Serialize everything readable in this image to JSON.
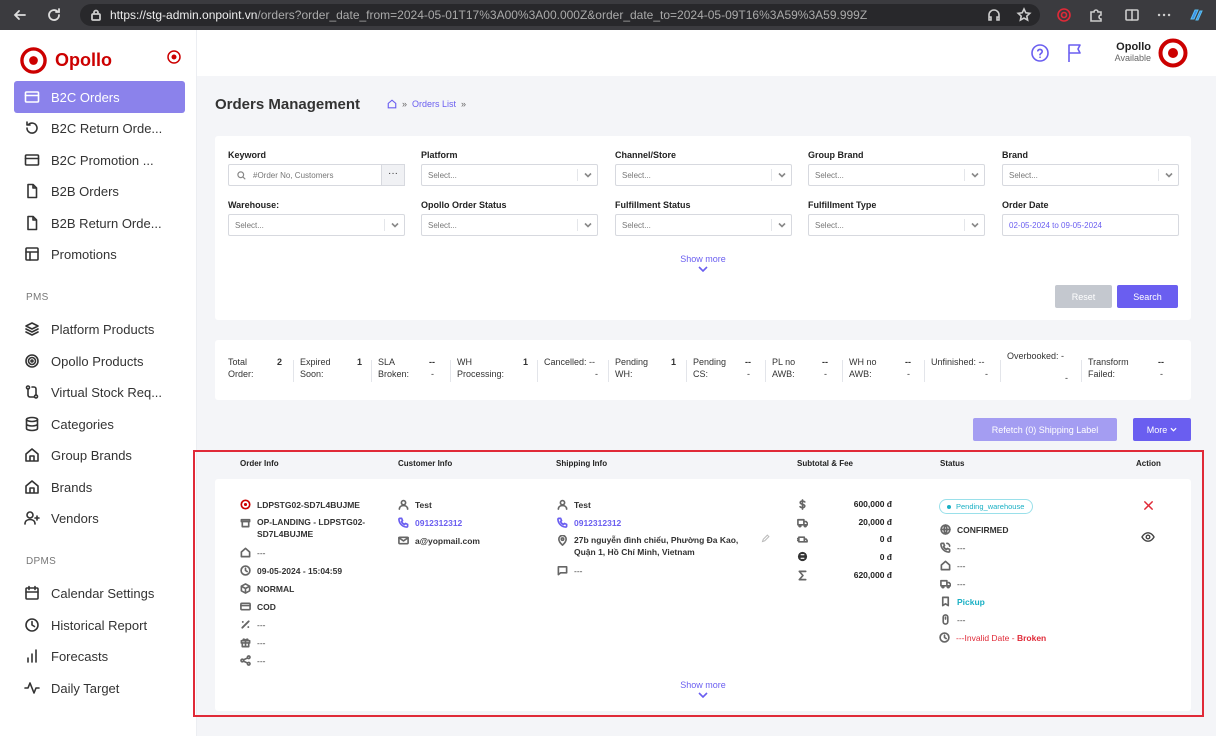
{
  "browser": {
    "url_host": "https://stg-admin.onpoint.vn",
    "url_rest": "/orders?order_date_from=2024-05-01T17%3A00%3A00.000Z&order_date_to=2024-05-09T16%3A59%3A59.999Z"
  },
  "sidebar": {
    "brand": "Opollo",
    "items": [
      {
        "label": "B2C Orders",
        "icon": "card-icon"
      },
      {
        "label": "B2C Return Orde...",
        "icon": "return-icon"
      },
      {
        "label": "B2C Promotion ...",
        "icon": "card-icon"
      },
      {
        "label": "B2B Orders",
        "icon": "file-icon"
      },
      {
        "label": "B2B Return Orde...",
        "icon": "file-icon"
      },
      {
        "label": "Promotions",
        "icon": "layout-icon"
      }
    ],
    "pms_label": "PMS",
    "pms_items": [
      {
        "label": "Platform Products",
        "icon": "layers-icon"
      },
      {
        "label": "Opollo Products",
        "icon": "target-icon"
      },
      {
        "label": "Virtual Stock Req...",
        "icon": "route-icon"
      },
      {
        "label": "Categories",
        "icon": "database-icon"
      },
      {
        "label": "Group Brands",
        "icon": "home-icon"
      },
      {
        "label": "Brands",
        "icon": "home-icon"
      },
      {
        "label": "Vendors",
        "icon": "user-plus-icon"
      }
    ],
    "dpms_label": "DPMS",
    "dpms_items": [
      {
        "label": "Calendar Settings",
        "icon": "calendar-icon"
      },
      {
        "label": "Historical Report",
        "icon": "clock-icon"
      },
      {
        "label": "Forecasts",
        "icon": "bar-chart-icon"
      },
      {
        "label": "Daily Target",
        "icon": "activity-icon"
      }
    ]
  },
  "header": {
    "user_name": "Opollo",
    "user_status": "Available"
  },
  "page": {
    "title": "Orders Management",
    "breadcrumb_link": "Orders List",
    "sep": "»"
  },
  "filters": {
    "keyword_label": "Keyword",
    "keyword_placeholder": "#Order No, Customers",
    "keyword_btn": "···",
    "platform_label": "Platform",
    "channel_label": "Channel/Store",
    "group_brand_label": "Group Brand",
    "brand_label": "Brand",
    "warehouse_label": "Warehouse:",
    "order_status_label": "Opollo Order Status",
    "fulfillment_status_label": "Fulfillment Status",
    "fulfillment_type_label": "Fulfillment Type",
    "order_date_label": "Order Date",
    "select_placeholder": "Select...",
    "order_date_value": "02-05-2024 to 09-05-2024",
    "show_more": "Show more",
    "reset": "Reset",
    "search": "Search"
  },
  "stats": [
    {
      "l1": "Total",
      "l2": "Order:",
      "v1": "2",
      "v2": ""
    },
    {
      "l1": "Expired",
      "l2": "Soon:",
      "v1": "1",
      "v2": ""
    },
    {
      "l1": "SLA",
      "l2": "Broken:",
      "v1": "--",
      "v2": "-"
    },
    {
      "l1": "WH",
      "l2": "Processing:",
      "v1": "1",
      "v2": ""
    },
    {
      "l1": "Cancelled: --",
      "l2": "",
      "v1": "",
      "v2": "-"
    },
    {
      "l1": "Pending",
      "l2": "WH:",
      "v1": "1",
      "v2": ""
    },
    {
      "l1": "Pending",
      "l2": "CS:",
      "v1": "--",
      "v2": "-"
    },
    {
      "l1": "PL no",
      "l2": "AWB:",
      "v1": "--",
      "v2": "-"
    },
    {
      "l1": "WH no",
      "l2": "AWB:",
      "v1": "--",
      "v2": "-"
    },
    {
      "l1": "Unfinished: --",
      "l2": "",
      "v1": "",
      "v2": "-"
    },
    {
      "l1": "Overbooked: -",
      "l2": "",
      "v1": "",
      "v2": "-"
    },
    {
      "l1": "Transform",
      "l2": "Failed:",
      "v1": "--",
      "v2": "-"
    }
  ],
  "actions": {
    "refetch": "Refetch (0) Shipping Label",
    "more": "More"
  },
  "table": {
    "headers": [
      "Order Info",
      "Customer Info",
      "Shipping Info",
      "Subtotal & Fee",
      "Status",
      "Action"
    ],
    "order": {
      "order_no": "LDPSTG02-SD7L4BUJME",
      "store_l1": "OP-LANDING - LDPSTG02-",
      "store_l2": "SD7L4BUJME",
      "warehouse": "---",
      "date": "09-05-2024 - 15:04:59",
      "type": "NORMAL",
      "payment": "COD",
      "discount": "---",
      "gift": "---",
      "share": "---"
    },
    "customer": {
      "name": "Test",
      "phone": "0912312312",
      "email": "a@yopmail.com"
    },
    "shipping": {
      "name": "Test",
      "phone": "0912312312",
      "address_l1": "27b nguyễn đình chiểu, Phường Đa Kao,",
      "address_l2": "Quận 1, Hồ Chí Minh, Vietnam",
      "note": "---"
    },
    "fees": [
      "600,000 đ",
      "20,000 đ",
      "0 đ",
      "0 đ",
      "620,000 đ"
    ],
    "status": {
      "badge": "Pending_warehouse",
      "confirmed": "CONFIRMED",
      "s1": "---",
      "s2": "---",
      "s3": "---",
      "pickup": "Pickup",
      "s4": "---",
      "invalid": "---Invalid Date",
      "dash": " - ",
      "broken": "Broken"
    },
    "show_more": "Show more"
  }
}
